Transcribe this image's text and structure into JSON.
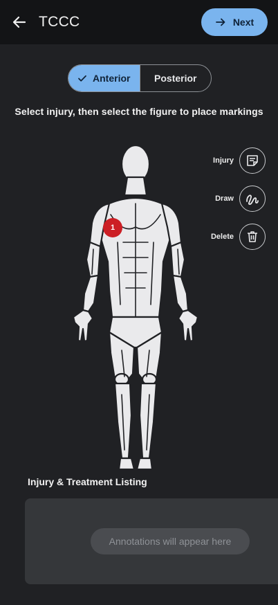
{
  "appbar": {
    "title": "TCCC",
    "back_icon": "arrow-left-icon",
    "next_label": "Next",
    "next_icon": "arrow-right-icon",
    "next_color": "#7ab4ee"
  },
  "view_toggle": {
    "options": [
      {
        "label": "Anterior",
        "selected": true
      },
      {
        "label": "Posterior",
        "selected": false
      }
    ],
    "check_icon": "check-icon"
  },
  "instruction": "Select injury, then select the figure to place markings",
  "tools": [
    {
      "label": "Injury",
      "icon": "note-icon"
    },
    {
      "label": "Draw",
      "icon": "squiggle-draw-icon"
    },
    {
      "label": "Delete",
      "icon": "trash-icon"
    }
  ],
  "markers": [
    {
      "number": "1",
      "color": "#cc1f25"
    }
  ],
  "listing": {
    "title": "Injury & Treatment Listing",
    "placeholder": "Annotations will appear here"
  }
}
